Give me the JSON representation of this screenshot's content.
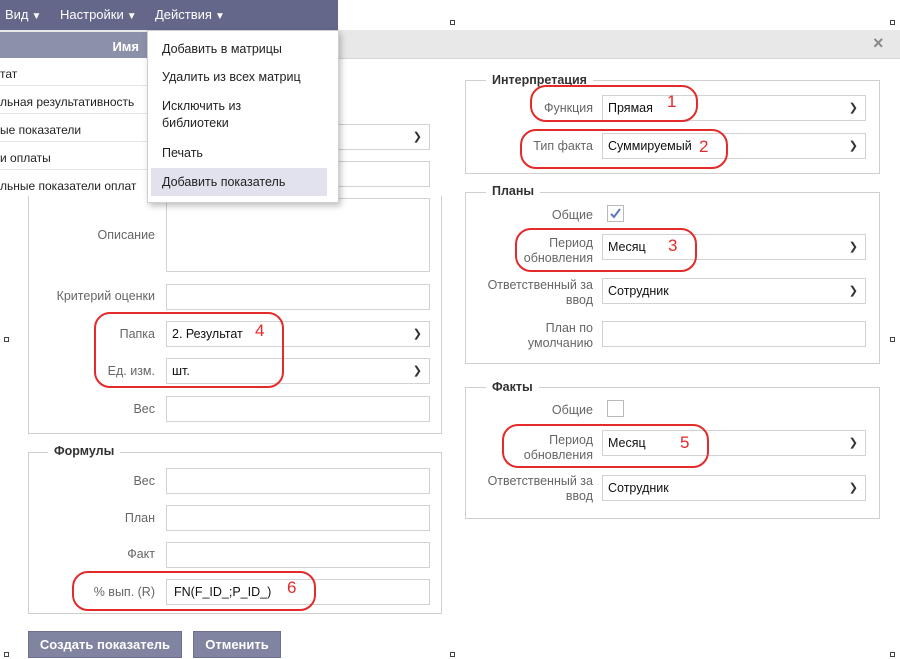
{
  "menubar": {
    "items": [
      {
        "label": "Вид"
      },
      {
        "label": "Настройки"
      },
      {
        "label": "Действия"
      }
    ]
  },
  "dialog": {
    "name_header": "Имя",
    "close": "×"
  },
  "left_list": [
    "тат",
    "льная результативность",
    "ые показатели",
    "и оплаты",
    "льные показатели оплат"
  ],
  "actions_menu": [
    "Добавить в матрицы",
    "Удалить из всех матриц",
    "Исключить из\nбиблиотеки",
    "Печать",
    "Добавить показатель"
  ],
  "main": {
    "description_label": "Описание",
    "criterion_label": "Критерий оценки",
    "folder_label": "Папка",
    "folder_value": "2. Результат",
    "unit_label": "Ед. изм.",
    "unit_value": "шт.",
    "weight_label": "Вес"
  },
  "formulas": {
    "legend": "Формулы",
    "weight_label": "Вес",
    "plan_label": "План",
    "fact_label": "Факт",
    "percent_label": "% вып. (R)",
    "percent_value": "FN(F_ID_;P_ID_)"
  },
  "interpretation": {
    "legend": "Интерпретация",
    "function_label": "Функция",
    "function_value": "Прямая",
    "fact_type_label": "Тип факта",
    "fact_type_value": "Суммируемый"
  },
  "plans": {
    "legend": "Планы",
    "common_label": "Общие",
    "common_checked": true,
    "period_label": "Период\nобновления",
    "period_value": "Месяц",
    "responsible_label": "Ответственный за\nввод",
    "responsible_value": "Сотрудник",
    "default_label": "План по\nумолчанию"
  },
  "facts": {
    "legend": "Факты",
    "common_label": "Общие",
    "common_checked": false,
    "period_label": "Период\nобновления",
    "period_value": "Месяц",
    "responsible_label": "Ответственный за\nввод",
    "responsible_value": "Сотрудник"
  },
  "annotations": [
    "1",
    "2",
    "3",
    "4",
    "5",
    "6"
  ],
  "buttons": {
    "create": "Создать показатель",
    "cancel": "Отменить"
  },
  "colors": {
    "accent": "#646789",
    "annotation": "#e42a2a",
    "button": "#8184a0"
  }
}
